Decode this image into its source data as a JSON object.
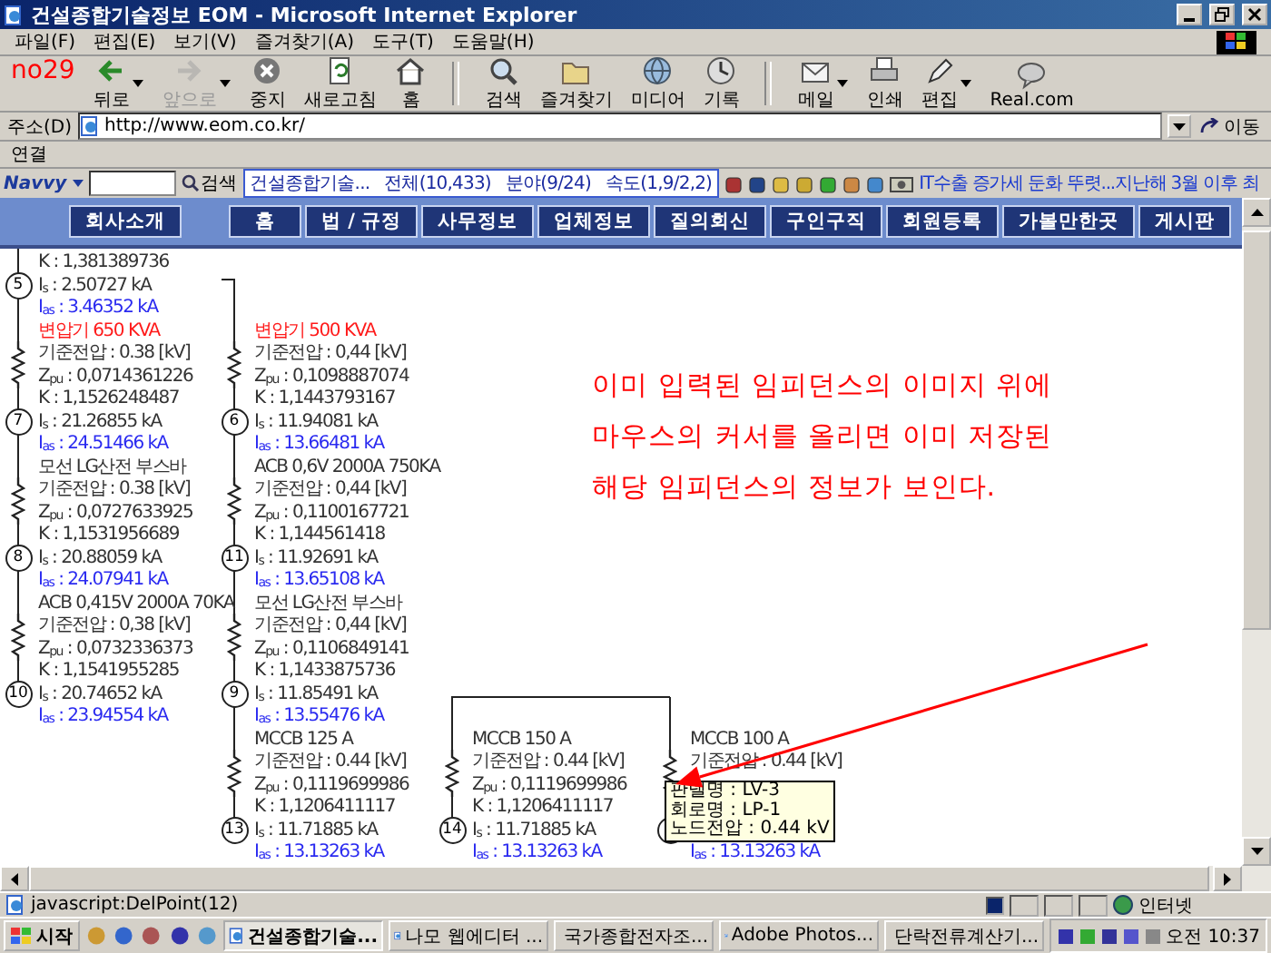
{
  "window": {
    "title": "건설종합기술정보 EOM - Microsoft Internet Explorer"
  },
  "annotation_label": "no29",
  "menu": [
    "파일(F)",
    "편집(E)",
    "보기(V)",
    "즐겨찾기(A)",
    "도구(T)",
    "도움말(H)"
  ],
  "toolbar": [
    {
      "label": "뒤로",
      "disabled": false,
      "dropdown": true
    },
    {
      "label": "앞으로",
      "disabled": true,
      "dropdown": true
    },
    {
      "label": "중지",
      "disabled": false,
      "dropdown": false
    },
    {
      "label": "새로고침",
      "disabled": false,
      "dropdown": false
    },
    {
      "label": "홈",
      "disabled": false,
      "dropdown": false
    },
    {
      "label": "검색",
      "disabled": false,
      "dropdown": false
    },
    {
      "label": "즐겨찾기",
      "disabled": false,
      "dropdown": false
    },
    {
      "label": "미디어",
      "disabled": false,
      "dropdown": false
    },
    {
      "label": "기록",
      "disabled": false,
      "dropdown": false
    },
    {
      "label": "메일",
      "disabled": false,
      "dropdown": true
    },
    {
      "label": "인쇄",
      "disabled": false,
      "dropdown": false
    },
    {
      "label": "편집",
      "disabled": false,
      "dropdown": true
    },
    {
      "label": "Real.com",
      "disabled": false,
      "dropdown": false
    }
  ],
  "address": {
    "label": "주소(D)",
    "value": "http://www.eom.co.kr/",
    "go": "이동"
  },
  "links_bar": {
    "label": "연결"
  },
  "navvy": {
    "brand": "Navvy",
    "search_button": "검색",
    "info": [
      "건설종합기술...",
      "전체(10,433)",
      "분야(9/24)",
      "속도(1,9/2,2)"
    ],
    "news": "IT수출 증가세 둔화 뚜렷...지난해 3월 이후 최"
  },
  "site_nav": [
    "회사소개",
    "홈",
    "법 / 규정",
    "사무정보",
    "업체정보",
    "질의회신",
    "구인구직",
    "회원등록",
    "가볼만한곳",
    "게시판"
  ],
  "diagram": {
    "columns": [
      {
        "items": [
          {
            "kind": "impedance",
            "lines": [
              "K : 1,381389736"
            ]
          },
          {
            "kind": "node",
            "number": "5",
            "is": "I$_{s}$ : 2.50727 kA",
            "ias": "I$_{as}$ : 3.46352 kA"
          },
          {
            "kind": "transformer",
            "name": "변압기 650 KVA",
            "lines": [
              "기준전압 : 0.38 [kV]",
              "Z$_{pu}$ : 0,0714361226",
              "K : 1,1526248487"
            ]
          },
          {
            "kind": "node",
            "number": "7",
            "is": "I$_{s}$ : 21.26855 kA",
            "ias": "I$_{as}$ : 24.51466 kA"
          },
          {
            "kind": "impedance",
            "name": "모선 LG산전 부스바",
            "lines": [
              "기준전압 : 0.38 [kV]",
              "Z$_{pu}$ : 0,0727633925",
              "K : 1,1531956689"
            ]
          },
          {
            "kind": "node",
            "number": "8",
            "is": "I$_{s}$ : 20.88059 kA",
            "ias": "I$_{as}$ : 24.07941 kA"
          },
          {
            "kind": "impedance",
            "name": "ACB 0,415V 2000A 70KA",
            "lines": [
              "기준전압 : 0,38 [kV]",
              "Z$_{pu}$ : 0,0732336373",
              "K : 1,1541955285"
            ]
          },
          {
            "kind": "node",
            "number": "10",
            "is": "I$_{s}$ : 20.74652 kA",
            "ias": "I$_{as}$ : 23.94554 kA"
          }
        ]
      },
      {
        "items": [
          {
            "kind": "transformer",
            "name": "변압기 500 KVA",
            "lines": [
              "기준전압 : 0,44 [kV]",
              "Z$_{pu}$ : 0,1098887074",
              "K : 1,1443793167"
            ]
          },
          {
            "kind": "node",
            "number": "6",
            "is": "I$_{s}$ : 11.94081 kA",
            "ias": "I$_{as}$ : 13.66481 kA"
          },
          {
            "kind": "impedance",
            "name": "ACB 0,6V 2000A 750KA",
            "lines": [
              "기준전압 : 0,44 [kV]",
              "Z$_{pu}$ : 0,1100167721",
              "K : 1,144561418"
            ]
          },
          {
            "kind": "node",
            "number": "11",
            "is": "I$_{s}$ : 11.92691 kA",
            "ias": "I$_{as}$ : 13.65108 kA"
          },
          {
            "kind": "impedance",
            "name": "모선 LG산전 부스바",
            "lines": [
              "기준전압 : 0,44 [kV]",
              "Z$_{pu}$ : 0,1106849141",
              "K : 1,1433875736"
            ]
          },
          {
            "kind": "node",
            "number": "9",
            "is": "I$_{s}$ : 11.85491 kA",
            "ias": "I$_{as}$ : 13.55476 kA"
          },
          {
            "kind": "impedance",
            "name": "MCCB 125 A",
            "lines": [
              "기준전압 : 0.44 [kV]",
              "Z$_{pu}$ : 0,1119699986",
              "K : 1,1206411117"
            ]
          },
          {
            "kind": "node",
            "number": "13",
            "is": "I$_{s}$ : 11.71885 kA",
            "ias": "I$_{as}$ : 13.13263 kA"
          }
        ]
      },
      {
        "items": [
          {
            "kind": "impedance",
            "name": "MCCB 150 A",
            "lines": [
              "기준전압 : 0.44 [kV]",
              "Z$_{pu}$ : 0,1119699986",
              "K : 1,1206411117"
            ]
          },
          {
            "kind": "node",
            "number": "14",
            "is": "I$_{s}$ : 11.71885 kA",
            "ias": "I$_{as}$ : 13.13263 kA"
          }
        ]
      },
      {
        "items": [
          {
            "kind": "impedance",
            "name": "MCCB 100 A",
            "lines": [
              "기준전압 : 0.44 [kV]"
            ]
          },
          {
            "kind": "node",
            "ias": "I$_{as}$ : 13.13263 kA"
          }
        ]
      }
    ]
  },
  "annotation": {
    "lines": [
      "이미 입력된 임피던스의 이미지 위에",
      "마우스의 커서를 올리면 이미 저장된",
      "해당 임피던스의 정보가 보인다."
    ]
  },
  "tooltip": {
    "lines": [
      "판넬명 : LV-3",
      "회로명 : LP-1",
      "노드전압 : 0.44 kV"
    ]
  },
  "status_bar": {
    "text": "javascript:DelPoint(12)",
    "zone": "인터넷"
  },
  "taskbar": {
    "start": "시작",
    "tasks": [
      {
        "label": "건설종합기술...",
        "selected": true
      },
      {
        "label": "나모 웹에디터 ...",
        "selected": false
      },
      {
        "label": "국가종합전자조...",
        "selected": false
      },
      {
        "label": "Adobe Photos...",
        "selected": false
      },
      {
        "label": "단락전류계산기...",
        "selected": false
      }
    ],
    "clock": "오전 10:37"
  }
}
